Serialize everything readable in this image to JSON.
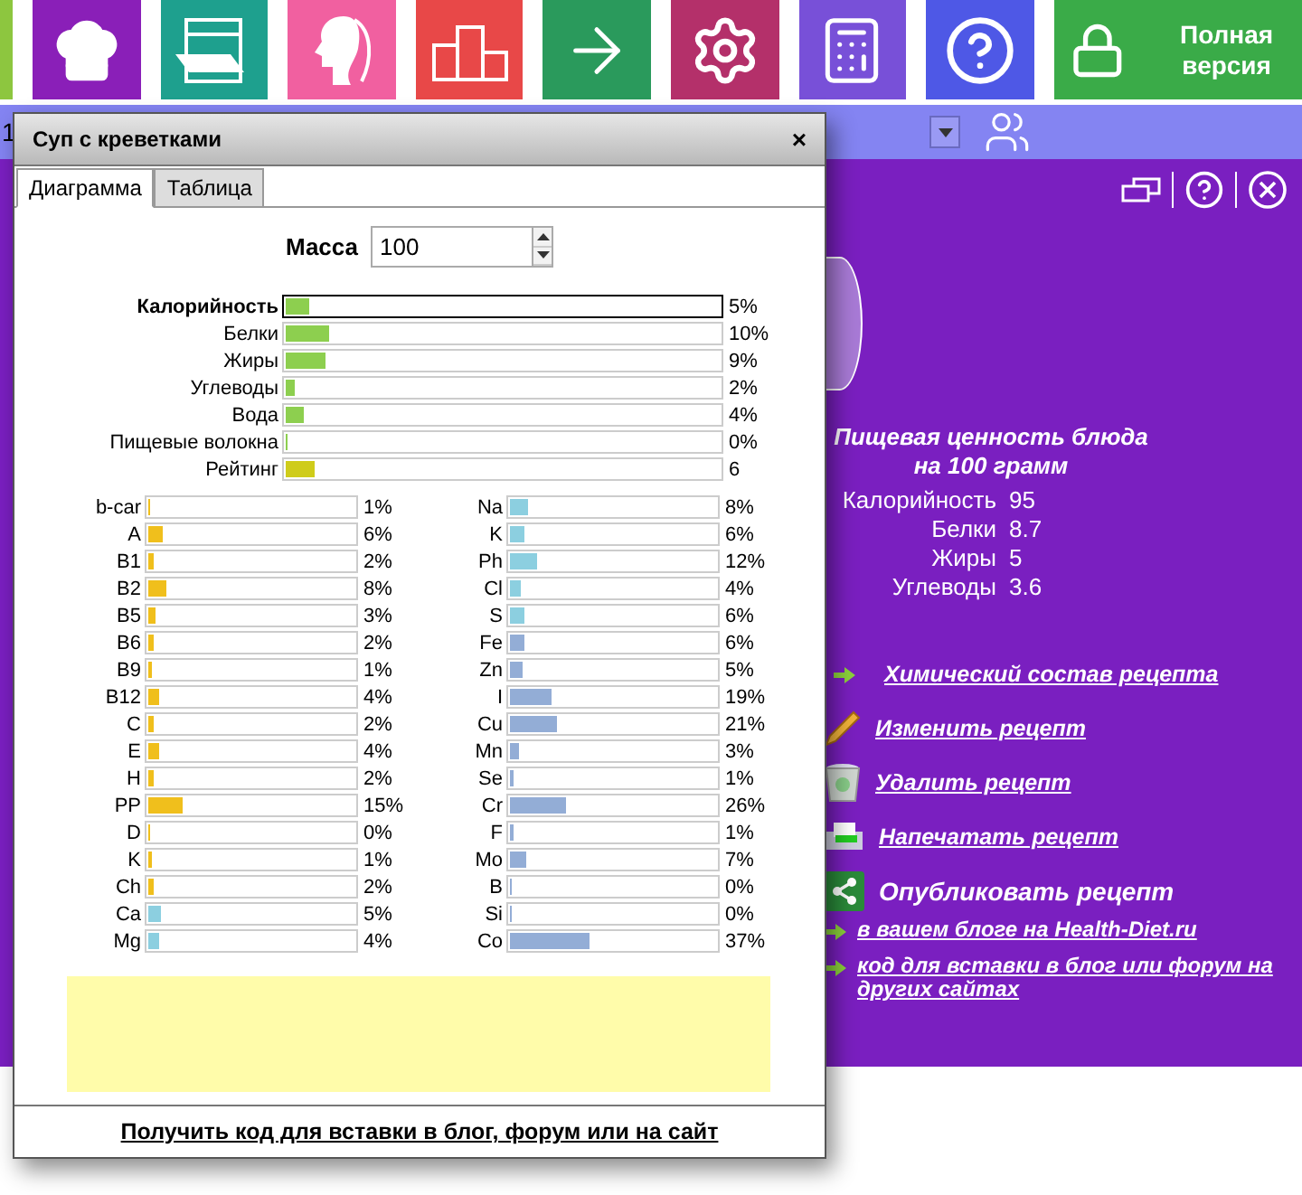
{
  "top_toolbar": {
    "tiles": [
      {
        "color": "#8a1fb8"
      },
      {
        "color": "#1ea08e"
      },
      {
        "color": "#f160a0"
      },
      {
        "color": "#e84848"
      },
      {
        "color": "#2a9a5c"
      },
      {
        "color": "#b4306a"
      },
      {
        "color": "#7850d8"
      },
      {
        "color": "#4e58e6"
      }
    ],
    "full_version": {
      "label": "Полная версия",
      "color": "#3aab48"
    }
  },
  "search_bar": {
    "value": "1"
  },
  "dialog": {
    "title": "Суп с креветками",
    "close": "×",
    "tabs": [
      {
        "label": "Диаграмма",
        "selected": true
      },
      {
        "label": "Таблица",
        "selected": false
      }
    ],
    "mass": {
      "label": "Масса",
      "value": "100"
    },
    "main_bars": [
      {
        "label": "Калорийность",
        "value": "5%",
        "level": 0.055,
        "color": "#8dcf4f",
        "selected": true
      },
      {
        "label": "Белки",
        "value": "10%",
        "level": 0.1,
        "color": "#8dcf4f",
        "selected": false
      },
      {
        "label": "Жиры",
        "value": "9%",
        "level": 0.09,
        "color": "#8dcf4f",
        "selected": false
      },
      {
        "label": "Углеводы",
        "value": "2%",
        "level": 0.02,
        "color": "#8dcf4f",
        "selected": false
      },
      {
        "label": "Вода",
        "value": "4%",
        "level": 0.04,
        "color": "#8dcf4f",
        "selected": false
      },
      {
        "label": "Пищевые волокна",
        "value": "0%",
        "level": 0,
        "color": "#8dcf4f",
        "selected": false
      },
      {
        "label": "Рейтинг",
        "value": "6",
        "level": 0.065,
        "color": "#cfcc1a",
        "selected": false
      }
    ],
    "micros_left": [
      {
        "label": "b-car",
        "value": "1%",
        "level": 0.01,
        "color": "#f0bf1c"
      },
      {
        "label": "A",
        "value": "6%",
        "level": 0.07,
        "color": "#f0bf1c"
      },
      {
        "label": "B1",
        "value": "2%",
        "level": 0.025,
        "color": "#f0bf1c"
      },
      {
        "label": "B2",
        "value": "8%",
        "level": 0.09,
        "color": "#f0bf1c"
      },
      {
        "label": "B5",
        "value": "3%",
        "level": 0.035,
        "color": "#f0bf1c"
      },
      {
        "label": "B6",
        "value": "2%",
        "level": 0.025,
        "color": "#f0bf1c"
      },
      {
        "label": "B9",
        "value": "1%",
        "level": 0.015,
        "color": "#f0bf1c"
      },
      {
        "label": "B12",
        "value": "4%",
        "level": 0.05,
        "color": "#f0bf1c"
      },
      {
        "label": "C",
        "value": "2%",
        "level": 0.025,
        "color": "#f0bf1c"
      },
      {
        "label": "E",
        "value": "4%",
        "level": 0.05,
        "color": "#f0bf1c"
      },
      {
        "label": "H",
        "value": "2%",
        "level": 0.025,
        "color": "#f0bf1c"
      },
      {
        "label": "PP",
        "value": "15%",
        "level": 0.16,
        "color": "#f0bf1c"
      },
      {
        "label": "D",
        "value": "0%",
        "level": 0,
        "color": "#f0bf1c"
      },
      {
        "label": "K",
        "value": "1%",
        "level": 0.015,
        "color": "#f0bf1c"
      },
      {
        "label": "Ch",
        "value": "2%",
        "level": 0.025,
        "color": "#f0bf1c"
      },
      {
        "label": "Ca",
        "value": "5%",
        "level": 0.06,
        "color": "#8ccfe0"
      },
      {
        "label": "Mg",
        "value": "4%",
        "level": 0.05,
        "color": "#8ccfe0"
      }
    ],
    "micros_right": [
      {
        "label": "Na",
        "value": "8%",
        "level": 0.09,
        "color": "#8ccfe0"
      },
      {
        "label": "K",
        "value": "6%",
        "level": 0.07,
        "color": "#8ccfe0"
      },
      {
        "label": "Ph",
        "value": "12%",
        "level": 0.13,
        "color": "#8ccfe0"
      },
      {
        "label": "Cl",
        "value": "4%",
        "level": 0.05,
        "color": "#8ccfe0"
      },
      {
        "label": "S",
        "value": "6%",
        "level": 0.07,
        "color": "#8ccfe0"
      },
      {
        "label": "Fe",
        "value": "6%",
        "level": 0.07,
        "color": "#93add6"
      },
      {
        "label": "Zn",
        "value": "5%",
        "level": 0.06,
        "color": "#93add6"
      },
      {
        "label": "I",
        "value": "19%",
        "level": 0.2,
        "color": "#93add6"
      },
      {
        "label": "Cu",
        "value": "21%",
        "level": 0.22,
        "color": "#93add6"
      },
      {
        "label": "Mn",
        "value": "3%",
        "level": 0.04,
        "color": "#93add6"
      },
      {
        "label": "Se",
        "value": "1%",
        "level": 0.015,
        "color": "#93add6"
      },
      {
        "label": "Cr",
        "value": "26%",
        "level": 0.27,
        "color": "#93add6"
      },
      {
        "label": "F",
        "value": "1%",
        "level": 0.015,
        "color": "#93add6"
      },
      {
        "label": "Mo",
        "value": "7%",
        "level": 0.08,
        "color": "#93add6"
      },
      {
        "label": "B",
        "value": "0%",
        "level": 0,
        "color": "#93add6"
      },
      {
        "label": "Si",
        "value": "0%",
        "level": 0,
        "color": "#93add6"
      },
      {
        "label": "Co",
        "value": "37%",
        "level": 0.38,
        "color": "#93add6"
      }
    ],
    "footer_link": "Получить код для вставки в блог, форум или на сайт"
  },
  "panel": {
    "nutrition": {
      "title": "Пищевая ценность блюда",
      "subtitle": "на 100 грамм",
      "rows": [
        {
          "label": "Калорийность",
          "value": "95"
        },
        {
          "label": "Белки",
          "value": "8.7"
        },
        {
          "label": "Жиры",
          "value": "5"
        },
        {
          "label": "Углеводы",
          "value": "3.6"
        }
      ]
    },
    "actions": [
      {
        "kind": "arrow",
        "label": "Химический состав рецепта"
      },
      {
        "kind": "pencil",
        "label": "Изменить рецепт"
      },
      {
        "kind": "trash",
        "label": "Удалить рецепт"
      },
      {
        "kind": "printer",
        "label": "Напечатать рецепт"
      },
      {
        "kind": "share",
        "label": "Опубликовать рецепт"
      },
      {
        "kind": "sublink",
        "label": "в вашем блоге на Health-Diet.ru"
      },
      {
        "kind": "sublink",
        "label": "код для вставки в блог или форум на других сайтах"
      }
    ]
  }
}
